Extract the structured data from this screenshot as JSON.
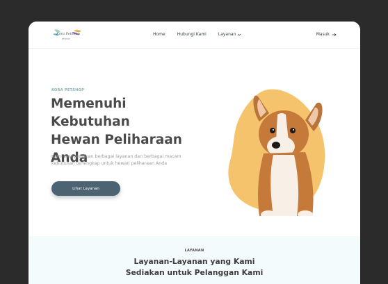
{
  "brand": {
    "logo_text": "Kora Petshop",
    "logo_sub": "PETSHOP"
  },
  "nav": {
    "home": "Home",
    "contact": "Hubungi Kami",
    "services": "Layanan",
    "login": "Masuk"
  },
  "hero": {
    "eyebrow": "KORA PETSHOP",
    "title_line1": "Memenuhi Kebutuhan",
    "title_line2": "Hewan Peliharaan",
    "title_line3": "Anda",
    "description": "Kami menyediakan berbagai layanan dan berbagai macam kebutuhan terlengkap untuk hewan peliharaan Anda",
    "cta_label": "Lihat Layanan"
  },
  "services": {
    "eyebrow": "LAYANAN",
    "title_line1": "Layanan-Layanan yang Kami",
    "title_line2": "Sediakan untuk Pelanggan Kami"
  },
  "colors": {
    "page_bg": "#2b2b2b",
    "accent_dark": "#4c6371",
    "blob": "#f6c36d",
    "eyebrow": "#7fb0bd",
    "services_bg": "#f4fbfc"
  }
}
